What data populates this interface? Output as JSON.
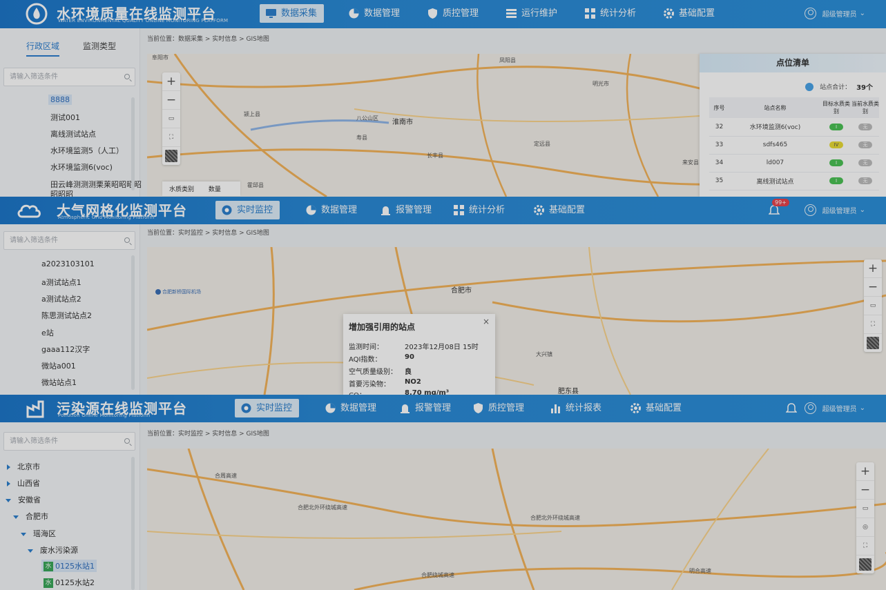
{
  "water": {
    "title": "水环境质量在线监测平台",
    "subtitle": "WATER ENVIRONMENTAL QUALITY ONLINE MONITORING PLATFORM",
    "nav": [
      "数据采集",
      "数据管理",
      "质控管理",
      "运行维护",
      "统计分析",
      "基础配置"
    ],
    "user": "超级管理员",
    "tabs": [
      "行政区域",
      "监测类型"
    ],
    "search_placeholder": "请输入筛选条件",
    "tree": [
      "8888",
      "测试001",
      "离线测试站点",
      "水环境监测5（人工）",
      "水环境监测6(voc)",
      "田云峰测测测栗莱昭昭昭昭",
      "昭昭昭"
    ],
    "breadcrumb": "当前位置：数据采集 > 实时信息 > GIS地图",
    "map_labels": [
      "阜阳市",
      "颍上县",
      "八公山区",
      "淮南市",
      "寿县",
      "长丰县",
      "凤阳县",
      "明光市",
      "定远县",
      "来安县",
      "霍邱县"
    ],
    "quick_tabs": [
      "水质类别",
      "数量"
    ],
    "point_list": {
      "title": "点位清单",
      "total_label": "站点合计：",
      "total_value": "39个",
      "headers": [
        "序号",
        "站点名称",
        "目标水质类别",
        "当前水质类别"
      ],
      "rows": [
        {
          "no": "32",
          "name": "水环境监测6(voc)",
          "target": "I",
          "current": "无"
        },
        {
          "no": "33",
          "name": "sdfs465",
          "target": "IV",
          "current": "无"
        },
        {
          "no": "34",
          "name": "ld007",
          "target": "I",
          "current": "无"
        },
        {
          "no": "35",
          "name": "离线测试站点",
          "target": "I",
          "current": "无"
        }
      ]
    }
  },
  "air": {
    "title": "大气网格化监测平台",
    "subtitle": "Atmospheric Grid Monitoring Platform",
    "nav": [
      "实时监控",
      "数据管理",
      "报警管理",
      "统计分析",
      "基础配置"
    ],
    "badge": "99+",
    "user": "超级管理员",
    "search_placeholder": "请输入筛选条件",
    "tree": [
      "a2023103101",
      "a测试站点1",
      "a测试站点2",
      "陈思测试站点2",
      "e站",
      "gaaa112汉字",
      "微站a001",
      "微站站点1"
    ],
    "breadcrumb": "当前位置：实时监控 > 实时信息 > GIS地图",
    "map_labels": [
      "合肥新桥国际机场",
      "合肥市",
      "肥东县",
      "大兴镇"
    ],
    "popup": {
      "title": "增加强引用的站点",
      "close": "×",
      "rows": [
        {
          "label": "监测时间：",
          "value": "2023年12月08日 15时"
        },
        {
          "label": "AQI指数：",
          "value": "90"
        },
        {
          "label": "空气质量级别：",
          "value": "良"
        },
        {
          "label": "首要污染物：",
          "value": "NO2"
        },
        {
          "label": "CO：",
          "value": "8.70 mg/m³"
        }
      ]
    }
  },
  "pollution": {
    "title": "污染源在线监测平台",
    "subtitle": "Pollution Online Monitoring Platform",
    "nav": [
      "实时监控",
      "数据管理",
      "报警管理",
      "质控管理",
      "统计报表",
      "基础配置"
    ],
    "user": "超级管理员",
    "search_placeholder": "请输入筛选条件",
    "tree": [
      {
        "label": "北京市",
        "level": 0,
        "state": "collapsed"
      },
      {
        "label": "山西省",
        "level": 0,
        "state": "collapsed"
      },
      {
        "label": "安徽省",
        "level": 0,
        "state": "expanded"
      },
      {
        "label": "合肥市",
        "level": 1,
        "state": "expanded"
      },
      {
        "label": "瑶海区",
        "level": 2,
        "state": "expanded"
      },
      {
        "label": "废水污染源",
        "level": 3,
        "state": "expanded"
      },
      {
        "label": "0125水站1",
        "level": 4,
        "state": "leaf"
      },
      {
        "label": "0125水站2",
        "level": 4,
        "state": "leaf"
      }
    ],
    "leaf_icon_text": "水",
    "breadcrumb": "当前位置：实时监控 > 实时信息 > GIS地图",
    "map_labels": [
      "合肥北外环绕城高速",
      "合肥北外环绕城高速",
      "合肥绕城高速",
      "合周高速",
      "明合高速"
    ]
  }
}
